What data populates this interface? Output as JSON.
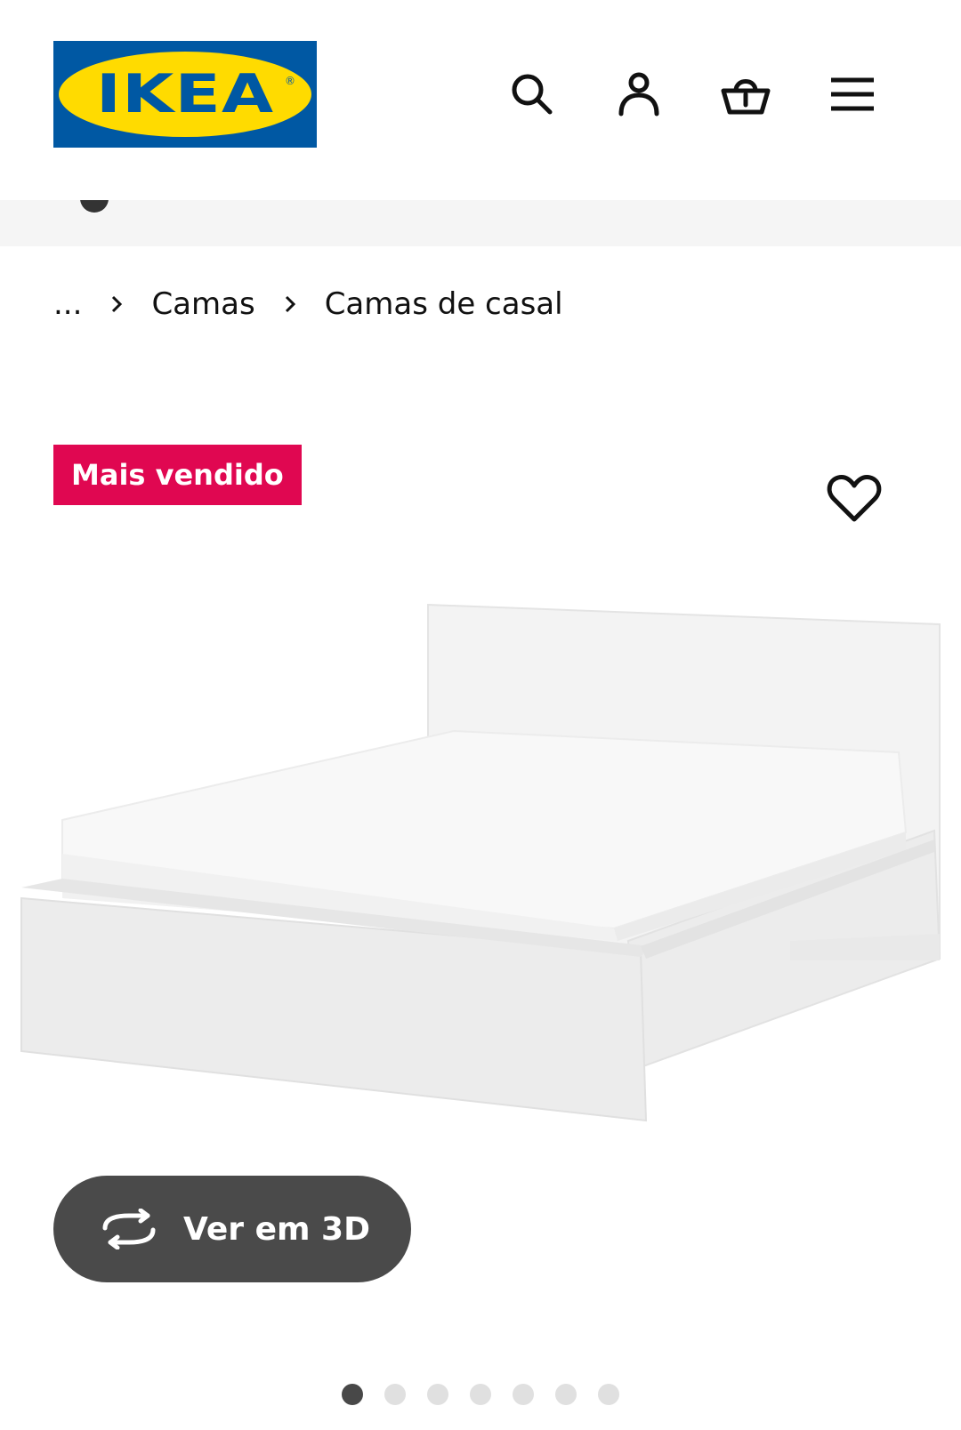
{
  "header": {
    "logo_text": "IKEA",
    "logo_mark": "®",
    "icons": [
      "search-icon",
      "account-icon",
      "basket-icon",
      "menu-icon"
    ]
  },
  "breadcrumb": {
    "ellipsis": "...",
    "items": [
      "Camas",
      "Camas de casal"
    ]
  },
  "product": {
    "badge": "Mais vendido",
    "view_3d_label": "Ver em 3D"
  },
  "carousel": {
    "total": 7,
    "active_index": 0
  },
  "colors": {
    "brand_blue": "#0058a3",
    "brand_yellow": "#ffdb00",
    "badge_red": "#e00751",
    "button_dark": "#4a4a4a"
  }
}
